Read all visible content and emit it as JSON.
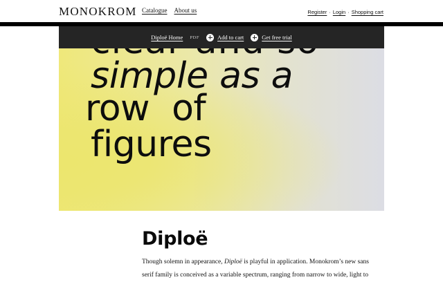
{
  "header": {
    "logo": "MONOKROM",
    "nav": [
      {
        "label": "Catalogue"
      },
      {
        "label": "About us"
      }
    ],
    "user_links": [
      {
        "label": "Register"
      },
      {
        "label": "Login"
      },
      {
        "label": "Shopping cart"
      }
    ],
    "separator": "·"
  },
  "toolbar": {
    "home_label": "Diploë Home",
    "pdf_label": "PDF",
    "add_to_cart_label": "Add to cart",
    "free_trial_label": "Get free trial"
  },
  "hero": {
    "lines": [
      "clear and so",
      "simple as a",
      "row of",
      "figures"
    ]
  },
  "content": {
    "title": "Diploë",
    "intro_before": "Though solemn in appearance, ",
    "intro_em": "Diploë",
    "intro_after": " is playful in application. Monokrom’s new sans serif family is conceived as a variable spectrum, ranging from narrow to wide, light to"
  },
  "colors": {
    "toolbar_bg": "#252525",
    "hero_yellow": "#ece66e",
    "hero_lavender": "#dcdde4",
    "rule": "#000000"
  },
  "icons": {
    "add_to_cart": "plus-circle-icon",
    "free_trial": "plus-circle-icon"
  }
}
